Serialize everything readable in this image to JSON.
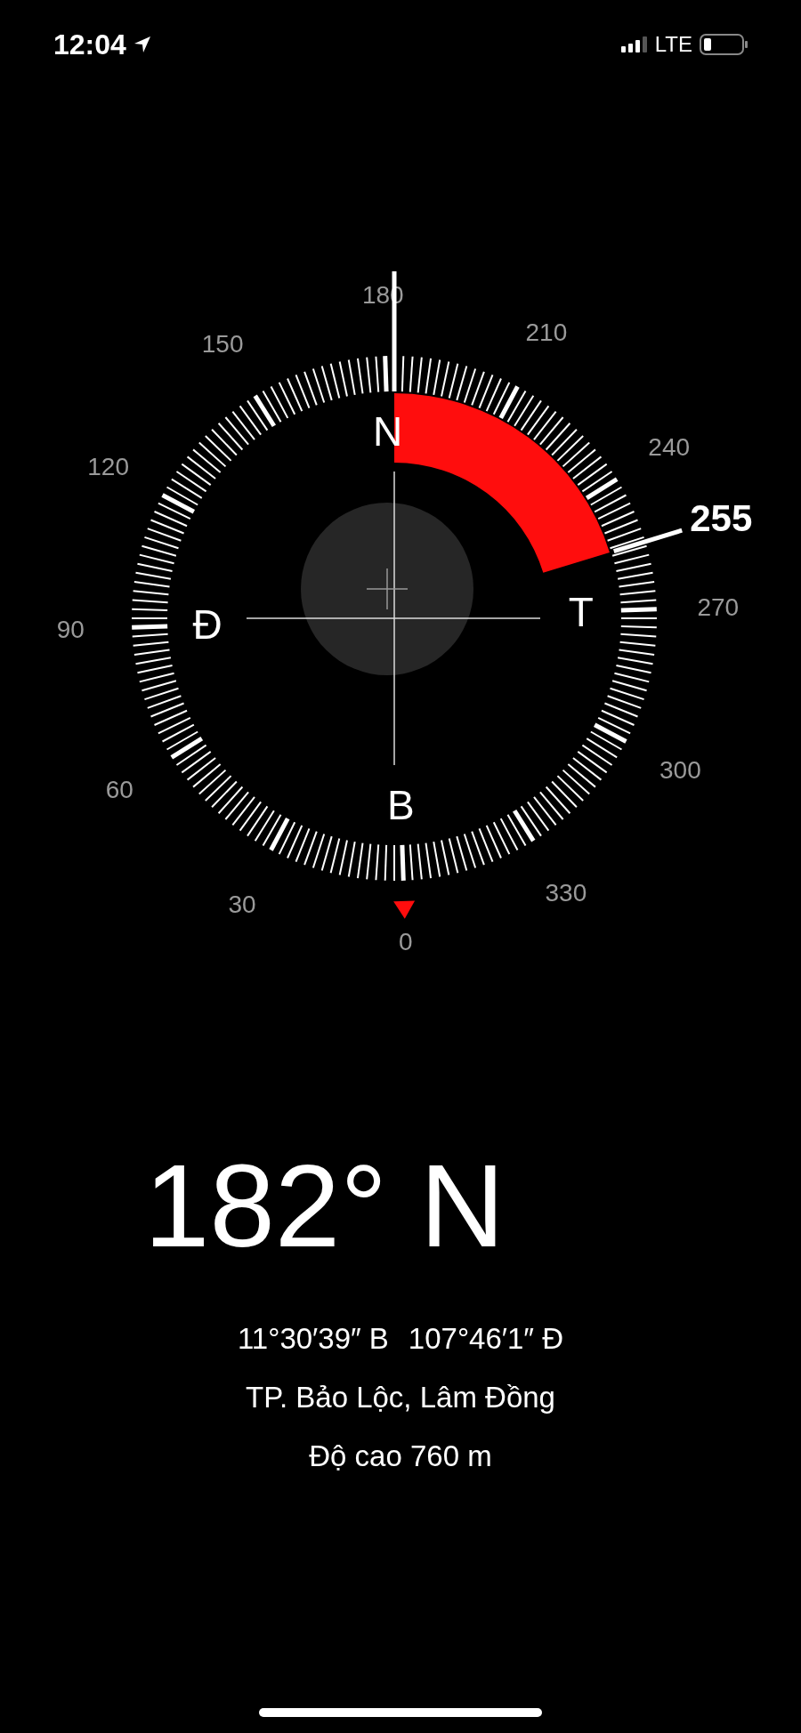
{
  "status_bar": {
    "time": "12:04",
    "network": "LTE"
  },
  "compass": {
    "degree_labels": [
      "0",
      "30",
      "60",
      "90",
      "120",
      "150",
      "180",
      "210",
      "240",
      "270",
      "300",
      "330"
    ],
    "cardinals": [
      "B",
      "Đ",
      "N",
      "T"
    ],
    "bearing_marker": "255"
  },
  "readout": {
    "heading": "182° N",
    "coordinates": [
      "11°30′39″ B",
      "107°46′1″ Đ"
    ],
    "place": "TP. Bảo Lộc, Lâm Đồng",
    "elevation": "Độ cao 760 m"
  }
}
